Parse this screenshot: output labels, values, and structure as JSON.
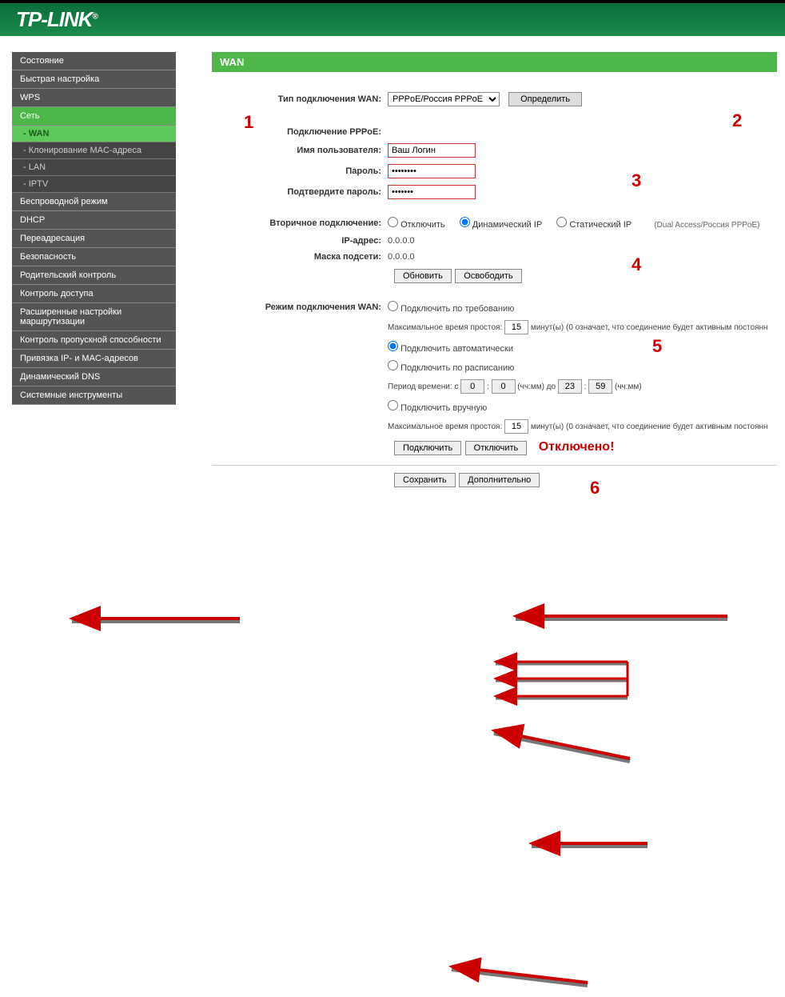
{
  "logo": "TP-LINK",
  "pageTitle": "WAN",
  "menu": {
    "status": "Состояние",
    "quickSetup": "Быстрая настройка",
    "wps": "WPS",
    "network": "Сеть",
    "wan": "- WAN",
    "macClone": "- Клонирование MAC-адреса",
    "lan": "- LAN",
    "iptv": "- IPTV",
    "wireless": "Беспроводной режим",
    "dhcp": "DHCP",
    "forwarding": "Переадресация",
    "security": "Безопасность",
    "parental": "Родительский контроль",
    "accessControl": "Контроль доступа",
    "advRouting": "Расширенные настройки маршрутизации",
    "bandwidth": "Контроль пропускной способности",
    "ipmac": "Привязка IP- и MAC-адресов",
    "ddns": "Динамический DNS",
    "sysTools": "Системные инструменты"
  },
  "labels": {
    "wanType": "Тип подключения WAN:",
    "pppoeConn": "Подключение PPPoE:",
    "username": "Имя пользователя:",
    "password": "Пароль:",
    "confirmPassword": "Подтвердите пароль:",
    "secondaryConn": "Вторичное подключение:",
    "ipAddr": "IP-адрес:",
    "subnetMask": "Маска подсети:",
    "wanMode": "Режим подключения WAN:",
    "maxIdle": "Максимальное время простоя:",
    "timePeriod": "Период времени: с",
    "detect": "Определить",
    "refresh": "Обновить",
    "release": "Освободить",
    "connect": "Подключить",
    "disconnectBtn": "Отключить",
    "save": "Сохранить",
    "advanced": "Дополнительно",
    "disconnected": "Отключено!"
  },
  "options": {
    "wanType": "PPPoE/Россия PPPoE",
    "disable": "Отключить",
    "dynamicIP": "Динамический IP",
    "staticIP": "Статический IP",
    "dualAccess": "(Dual Access/Россия PPPoE)",
    "onDemand": "Подключить по требованию",
    "auto": "Подключить автоматически",
    "scheduled": "Подключить по расписанию",
    "manual": "Подключить вручную"
  },
  "values": {
    "username": "Ваш Логин",
    "password": "••••••••",
    "confirmPassword": "•••••••",
    "ipAddr": "0.0.0.0",
    "subnetMask": "0.0.0.0",
    "idle": "15",
    "timeFrom1": "0",
    "timeFrom2": "0",
    "timeTo1": "23",
    "timeTo2": "59",
    "minutesNote": "минут(ы) (0 означает, что соединение будет активным постоянн",
    "hhmmFrom": "(чч:мм) до",
    "hhmmTo": "(чч:мм)"
  },
  "annotations": {
    "1": "1",
    "2": "2",
    "3": "3",
    "4": "4",
    "5": "5",
    "6": "6"
  }
}
